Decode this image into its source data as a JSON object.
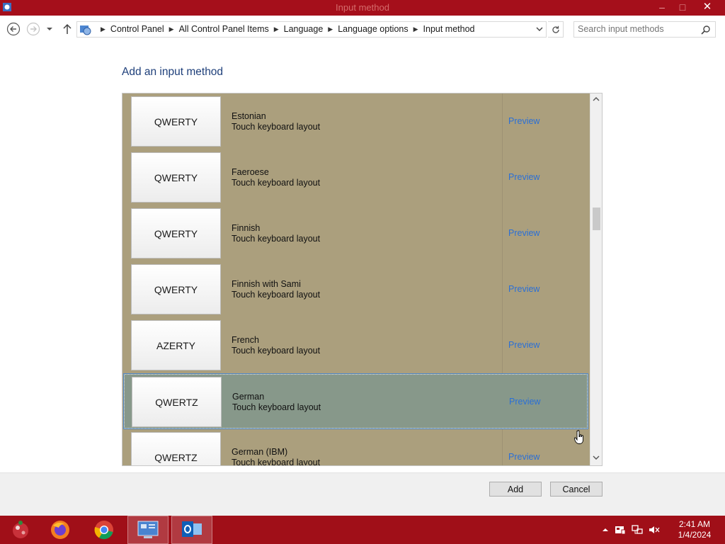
{
  "window": {
    "title": "Input method",
    "minimize": "–",
    "maximize": "□",
    "close": "✕"
  },
  "address": {
    "crumbs": [
      "Control Panel",
      "All Control Panel Items",
      "Language",
      "Language options",
      "Input method"
    ],
    "search_placeholder": "Search input methods"
  },
  "page": {
    "heading": "Add an input method"
  },
  "list": {
    "scroll_position": 0.31,
    "items": [
      {
        "layout": "QWERTY",
        "name": "Estonian",
        "subtitle": "Touch keyboard layout",
        "link": "Preview",
        "selected": false
      },
      {
        "layout": "QWERTY",
        "name": "Faeroese",
        "subtitle": "Touch keyboard layout",
        "link": "Preview",
        "selected": false
      },
      {
        "layout": "QWERTY",
        "name": "Finnish",
        "subtitle": "Touch keyboard layout",
        "link": "Preview",
        "selected": false
      },
      {
        "layout": "QWERTY",
        "name": "Finnish with Sami",
        "subtitle": "Touch keyboard layout",
        "link": "Preview",
        "selected": false
      },
      {
        "layout": "AZERTY",
        "name": "French",
        "subtitle": "Touch keyboard layout",
        "link": "Preview",
        "selected": false
      },
      {
        "layout": "QWERTZ",
        "name": "German",
        "subtitle": "Touch keyboard layout",
        "link": "Preview",
        "selected": true
      },
      {
        "layout": "QWERTZ",
        "name": "German (IBM)",
        "subtitle": "Touch keyboard layout",
        "link": "Preview",
        "selected": false
      }
    ]
  },
  "footer": {
    "add_label": "Add",
    "cancel_label": "Cancel"
  },
  "taskbar": {
    "apps": [
      "start-icon",
      "firefox-icon",
      "chrome-icon",
      "control-panel-icon",
      "outlook-icon"
    ],
    "active_app": "control-panel-icon",
    "time": "2:41 AM",
    "date": "1/4/2024"
  },
  "colors": {
    "title_bar": "#a50f1b",
    "taskbar": "#a00f18",
    "list_background": "#ab9f7d",
    "selected_row": "#87988a",
    "link": "#2a6fd6",
    "heading": "#1e3f7a"
  }
}
